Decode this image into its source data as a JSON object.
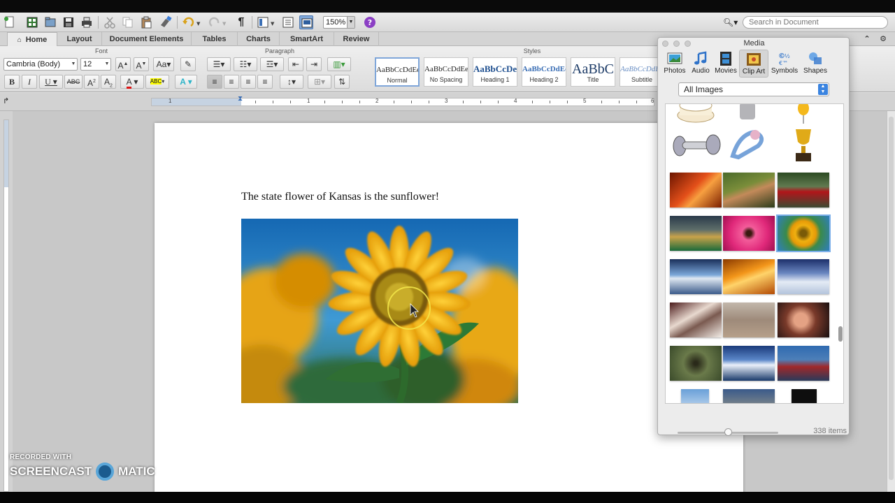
{
  "toolbar": {
    "zoom": "150%",
    "search_placeholder": "Search in Document"
  },
  "tabs": [
    "Home",
    "Layout",
    "Document Elements",
    "Tables",
    "Charts",
    "SmartArt",
    "Review"
  ],
  "ribbon": {
    "groups": {
      "font": "Font",
      "paragraph": "Paragraph",
      "styles": "Styles"
    },
    "font_name": "Cambria (Body)",
    "font_size": "12",
    "styles": [
      {
        "sample": "AaBbCcDdEe",
        "name": "Normal"
      },
      {
        "sample": "AaBbCcDdEe",
        "name": "No Spacing"
      },
      {
        "sample": "AaBbCcDe",
        "name": "Heading 1"
      },
      {
        "sample": "AaBbCcDdEe",
        "name": "Heading 2"
      },
      {
        "sample": "AaBbC",
        "name": "Title"
      },
      {
        "sample": "AaBbCcDdEe",
        "name": "Subtitle"
      }
    ]
  },
  "ruler": {
    "labels": [
      "1",
      "1",
      "2",
      "3",
      "4",
      "5",
      "6"
    ]
  },
  "document": {
    "text": "The state flower of Kansas is the sunflower!"
  },
  "media": {
    "title": "Media",
    "tabs": [
      "Photos",
      "Audio",
      "Movies",
      "Clip Art",
      "Symbols",
      "Shapes"
    ],
    "category": "All Images",
    "item_count": "338 items"
  },
  "watermark": {
    "line1": "RECORDED WITH",
    "line2a": "SCREENCAST",
    "line2b": "MATIC"
  }
}
